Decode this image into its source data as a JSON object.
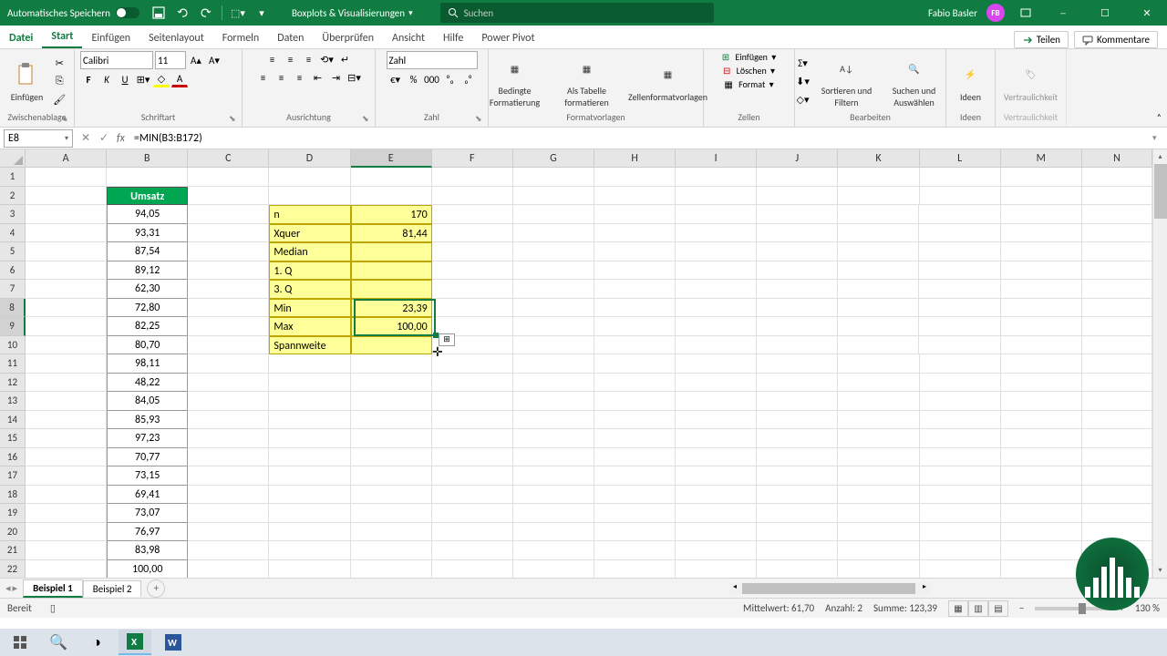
{
  "titlebar": {
    "autosave_label": "Automatisches Speichern",
    "doc_title": "Boxplots & Visualisierungen",
    "search_placeholder": "Suchen",
    "user_name": "Fabio Basler",
    "user_initials": "FB"
  },
  "tabs": {
    "file": "Datei",
    "items": [
      "Start",
      "Einfügen",
      "Seitenlayout",
      "Formeln",
      "Daten",
      "Überprüfen",
      "Ansicht",
      "Hilfe",
      "Power Pivot"
    ],
    "active": "Start",
    "share": "Teilen",
    "comments": "Kommentare"
  },
  "ribbon": {
    "clipboard": {
      "label": "Zwischenablage",
      "paste": "Einfügen"
    },
    "font": {
      "label": "Schriftart",
      "name": "Calibri",
      "size": "11"
    },
    "alignment": {
      "label": "Ausrichtung"
    },
    "number": {
      "label": "Zahl",
      "format": "Zahl"
    },
    "styles": {
      "label": "Formatvorlagen",
      "cond": "Bedingte Formatierung",
      "table": "Als Tabelle formatieren",
      "cellsty": "Zellenformatvorlagen"
    },
    "cells": {
      "label": "Zellen",
      "insert": "Einfügen",
      "delete": "Löschen",
      "format": "Format"
    },
    "editing": {
      "label": "Bearbeiten",
      "sort": "Sortieren und Filtern",
      "find": "Suchen und Auswählen"
    },
    "ideas": {
      "label": "Ideen",
      "btn": "Ideen"
    },
    "sensitivity": {
      "label": "Vertraulichkeit",
      "btn": "Vertraulichkeit"
    }
  },
  "formula_bar": {
    "cell_ref": "E8",
    "formula": "=MIN(B3:B172)"
  },
  "columns": [
    "A",
    "B",
    "C",
    "D",
    "E",
    "F",
    "G",
    "H",
    "I",
    "J",
    "K",
    "L",
    "M",
    "N"
  ],
  "selected_col": "E",
  "rows_visible": 22,
  "selected_rows": [
    8,
    9
  ],
  "col_b": {
    "header": "Umsatz",
    "values": [
      "94,05",
      "93,31",
      "87,54",
      "89,12",
      "62,30",
      "72,80",
      "82,25",
      "80,70",
      "98,11",
      "48,22",
      "84,05",
      "85,93",
      "97,23",
      "70,77",
      "73,15",
      "69,41",
      "73,07",
      "76,97",
      "83,98",
      "100,00"
    ]
  },
  "stats": {
    "rows": [
      {
        "label": "n",
        "value": "170"
      },
      {
        "label": "Xquer",
        "value": "81,44"
      },
      {
        "label": "Median",
        "value": ""
      },
      {
        "label": "1. Q",
        "value": ""
      },
      {
        "label": "3. Q",
        "value": ""
      },
      {
        "label": "Min",
        "value": "23,39"
      },
      {
        "label": "Max",
        "value": "100,00"
      },
      {
        "label": "Spannweite",
        "value": ""
      }
    ]
  },
  "sheets": {
    "tabs": [
      "Beispiel 1",
      "Beispiel 2"
    ],
    "active": "Beispiel 1"
  },
  "status": {
    "ready": "Bereit",
    "avg_label": "Mittelwert:",
    "avg": "61,70",
    "count_label": "Anzahl:",
    "count": "2",
    "sum_label": "Summe:",
    "sum": "123,39",
    "zoom": "130 %"
  }
}
